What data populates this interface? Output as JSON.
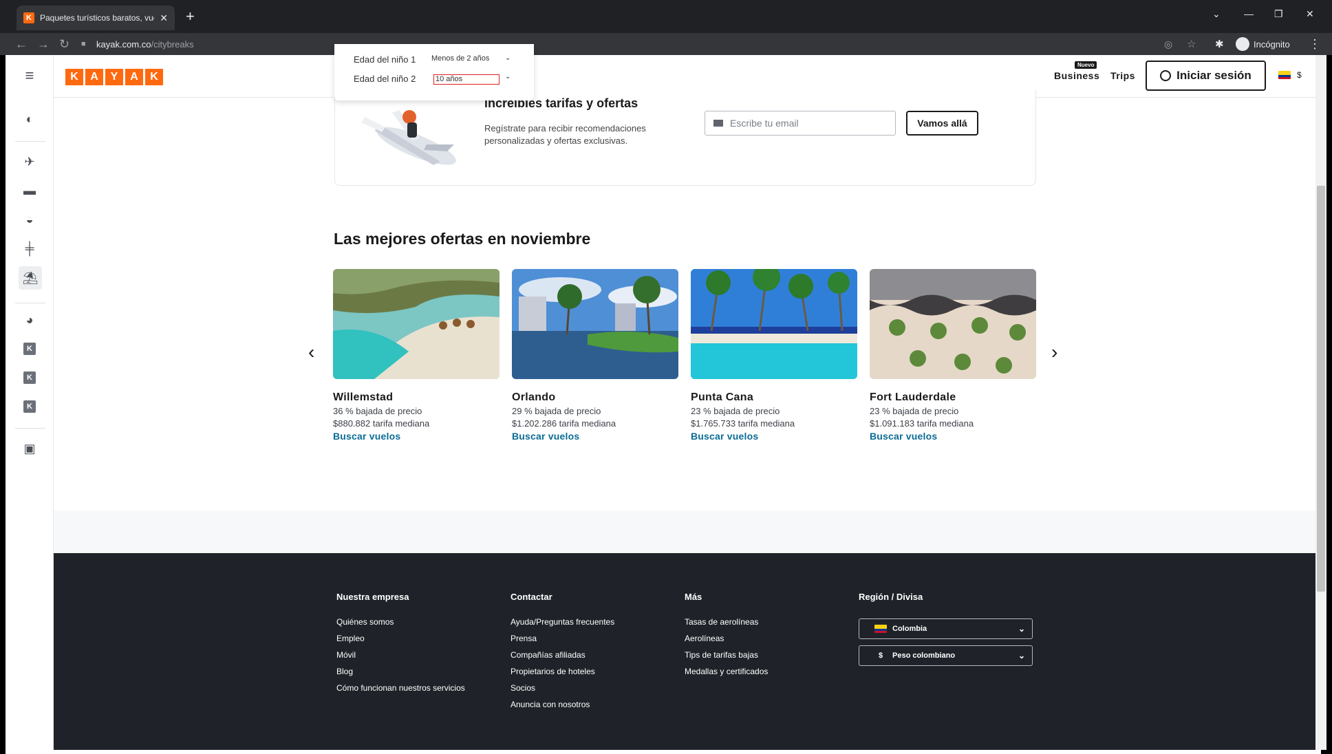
{
  "browser": {
    "tab_title": "Paquetes turísticos baratos, vuel",
    "favicon_letter": "K",
    "url_domain": "kayak.com.co",
    "url_path": "/citybreaks",
    "incognito_label": "Incógnito"
  },
  "header": {
    "logo_letters": [
      "K",
      "A",
      "Y",
      "A",
      "K"
    ],
    "business_badge": "Nuevo",
    "business_label": "Business",
    "trips_label": "Trips",
    "signin_label": "Iniciar sesión",
    "currency_symbol": "$"
  },
  "age_popup": {
    "child1_label": "Edad del niño 1",
    "child1_value": "Menos de 2 años",
    "child2_label": "Edad del niño 2",
    "child2_value": "10 años"
  },
  "newsletter": {
    "title": "increíbles tarifas y ofertas",
    "subtitle": "Regístrate para recibir recomendaciones personalizadas y ofertas exclusivas.",
    "email_placeholder": "Escribe tu email",
    "button_label": "Vamos allá"
  },
  "deals": {
    "title": "Las mejores ofertas en noviembre",
    "items": [
      {
        "city": "Willemstad",
        "drop": "36 % bajada de precio",
        "fare": "$880.882 tarifa mediana",
        "link": "Buscar vuelos"
      },
      {
        "city": "Orlando",
        "drop": "29 % bajada de precio",
        "fare": "$1.202.286 tarifa mediana",
        "link": "Buscar vuelos"
      },
      {
        "city": "Punta Cana",
        "drop": "23 % bajada de precio",
        "fare": "$1.765.733 tarifa mediana",
        "link": "Buscar vuelos"
      },
      {
        "city": "Fort Lauderdale",
        "drop": "23 % bajada de precio",
        "fare": "$1.091.183 tarifa mediana",
        "link": "Buscar vuelos"
      }
    ]
  },
  "footer": {
    "col1": {
      "title": "Nuestra empresa",
      "links": [
        "Quiénes somos",
        "Empleo",
        "Móvil",
        "Blog",
        "Cómo funcionan nuestros servicios"
      ]
    },
    "col2": {
      "title": "Contactar",
      "links": [
        "Ayuda/Preguntas frecuentes",
        "Prensa",
        "Compañías afiliadas",
        "Propietarios de hoteles",
        "Socios",
        "Anuncia con nosotros"
      ]
    },
    "col3": {
      "title": "Más",
      "links": [
        "Tasas de aerolíneas",
        "Aerolíneas",
        "Tips de tarifas bajas",
        "Medallas y certificados"
      ]
    },
    "region": {
      "title": "Región / Divisa",
      "country": "Colombia",
      "currency_symbol": "$",
      "currency": "Peso colombiano"
    }
  },
  "colors": {
    "brand": "#ff690f",
    "link": "#0a6c94",
    "footer_bg": "#1f2329"
  }
}
